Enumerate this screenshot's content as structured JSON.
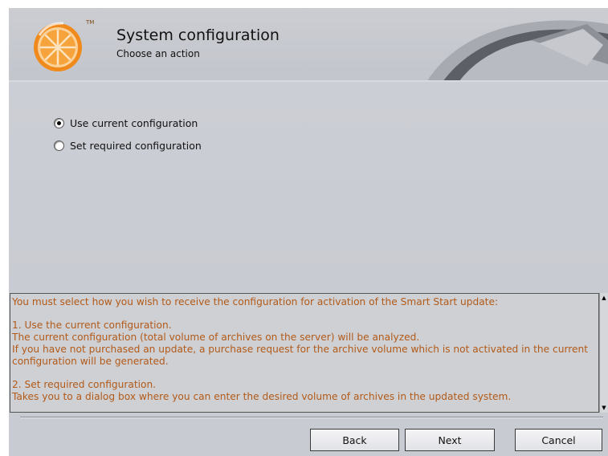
{
  "header": {
    "title": "System configuration",
    "subtitle": "Choose an action",
    "logo_icon": "orange-slice-logo",
    "logo_trademark": "TM"
  },
  "options": [
    {
      "label": "Use current configuration",
      "selected": true
    },
    {
      "label": "Set required configuration",
      "selected": false
    }
  ],
  "info_text": "You must select how you wish to receive the configuration for activation of the Smart Start update:\n\n1. Use the current configuration.\nThe current configuration (total volume of archives on the server) will be analyzed.\nIf you have not purchased an update, a purchase request for the archive volume which is not activated in the current configuration will be generated.\n\n2. Set required configuration.\nTakes you to a dialog box where you can enter the desired volume of archives in the updated system.",
  "buttons": {
    "back": "Back",
    "next": "Next",
    "cancel": "Cancel"
  },
  "colors": {
    "info_text": "#b25a18",
    "background": "#c9cbd2"
  }
}
